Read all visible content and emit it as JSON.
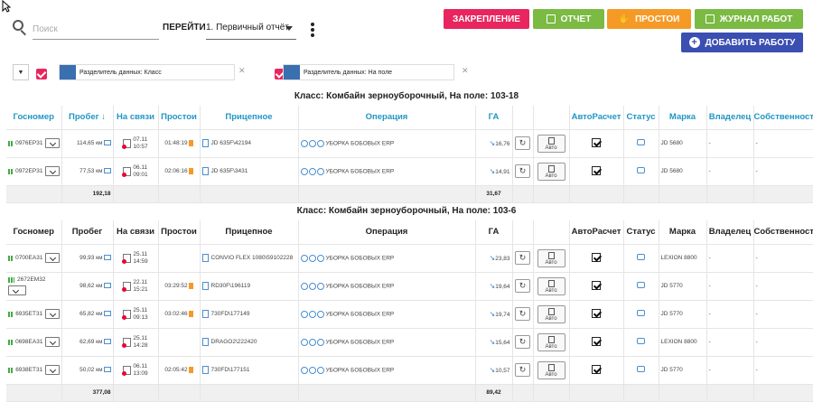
{
  "toolbar": {
    "search_placeholder": "Поиск",
    "go_label": "ПЕРЕЙТИ",
    "report_value": "1. Первичный отчёт",
    "btn_zak": "ЗАКРЕПЛЕНИЕ",
    "btn_otch": "ОТЧЕТ",
    "btn_prost": "ПРОСТОИ",
    "btn_jour": "ЖУРНАЛ РАБОТ",
    "btn_add": "ДОБАВИТЬ РАБОТУ",
    "colors": {
      "zak": "#e8255f",
      "green": "#7bba43",
      "orange": "#f69a27",
      "blue": "#3b4eb1"
    }
  },
  "filters": {
    "chip1": "Разделитель данных: Класс",
    "chip2": "Разделитель данных: На поле"
  },
  "headers1": [
    "Госномер",
    "Пробег ↓",
    "На связи",
    "Простои",
    "Прицепное",
    "Операция",
    "ГА",
    "",
    "",
    "АвтоРасчет",
    "Статус",
    "Марка",
    "Владелец",
    "Собственность"
  ],
  "headers2": [
    "Госномер",
    "Пробег",
    "На связи",
    "Простои",
    "Прицепное",
    "Операция",
    "ГА",
    "",
    "",
    "АвтоРасчет",
    "Статус",
    "Марка",
    "Владелец",
    "Собственность"
  ],
  "auto_label": "Авто",
  "section1": {
    "title": "Класс: Комбайн зерноуборочный, На поле: 103-18",
    "rows": [
      {
        "num": "0976ЕР31",
        "km": "114,65 км",
        "date": "07.11",
        "time": "10:57",
        "idle": "01:48:19",
        "trailer": "JD 635F\\42194",
        "op": "УБОРКА БОБОВЫХ ERP",
        "ga": "16,76",
        "brand": "JD 5680",
        "owner": "-",
        "prop": "-"
      },
      {
        "num": "0972ЕР31",
        "km": "77,53 км",
        "date": "06.11",
        "time": "09:01",
        "idle": "02:06:16",
        "trailer": "JD 635F\\3431",
        "op": "УБОРКА БОБОВЫХ ERP",
        "ga": "14,91",
        "brand": "JD 5680",
        "owner": "-",
        "prop": "-"
      }
    ],
    "total_km": "192,18",
    "total_ga": "31,67"
  },
  "section2": {
    "title": "Класс: Комбайн зерноуборочный, На поле: 103-6",
    "rows": [
      {
        "num": "0700ЕА31",
        "km": "99,93 км",
        "date": "25.11",
        "time": "14:59",
        "idle": "",
        "trailer": "CONVIO FLEX 1080\\59102228",
        "op": "УБОРКА БОБОВЫХ ERP",
        "ga": "23,83",
        "brand": "LEXION 8800",
        "owner": "-",
        "prop": "-"
      },
      {
        "num": "2672ЕМ32",
        "km": "98,62 км",
        "date": "22.11",
        "time": "15:21",
        "idle": "03:29:52",
        "trailer": "RD30F\\196119",
        "op": "УБОРКА БОБОВЫХ ERP",
        "ga": "19,64",
        "brand": "JD 5770",
        "owner": "-",
        "prop": "-"
      },
      {
        "num": "6935ЕТ31",
        "km": "65,82 км",
        "date": "25.11",
        "time": "09:13",
        "idle": "03:02:46",
        "trailer": "730FD\\177149",
        "op": "УБОРКА БОБОВЫХ ERP",
        "ga": "19,74",
        "brand": "JD 5770",
        "owner": "-",
        "prop": "-"
      },
      {
        "num": "0698ЕА31",
        "km": "62,69 км",
        "date": "25.11",
        "time": "14:28",
        "idle": "",
        "trailer": "DRAGO2\\222420",
        "op": "УБОРКА БОБОВЫХ ERP",
        "ga": "15,64",
        "brand": "LEXION 8800",
        "owner": "-",
        "prop": "-"
      },
      {
        "num": "6938ЕТ31",
        "km": "50,02 км",
        "date": "06.11",
        "time": "13:09",
        "idle": "02:05:42",
        "trailer": "730FD\\177151",
        "op": "УБОРКА БОБОВЫХ ERP",
        "ga": "10,57",
        "brand": "JD 5770",
        "owner": "-",
        "prop": "-"
      }
    ],
    "total_km": "377,08",
    "total_ga": "89,42"
  }
}
